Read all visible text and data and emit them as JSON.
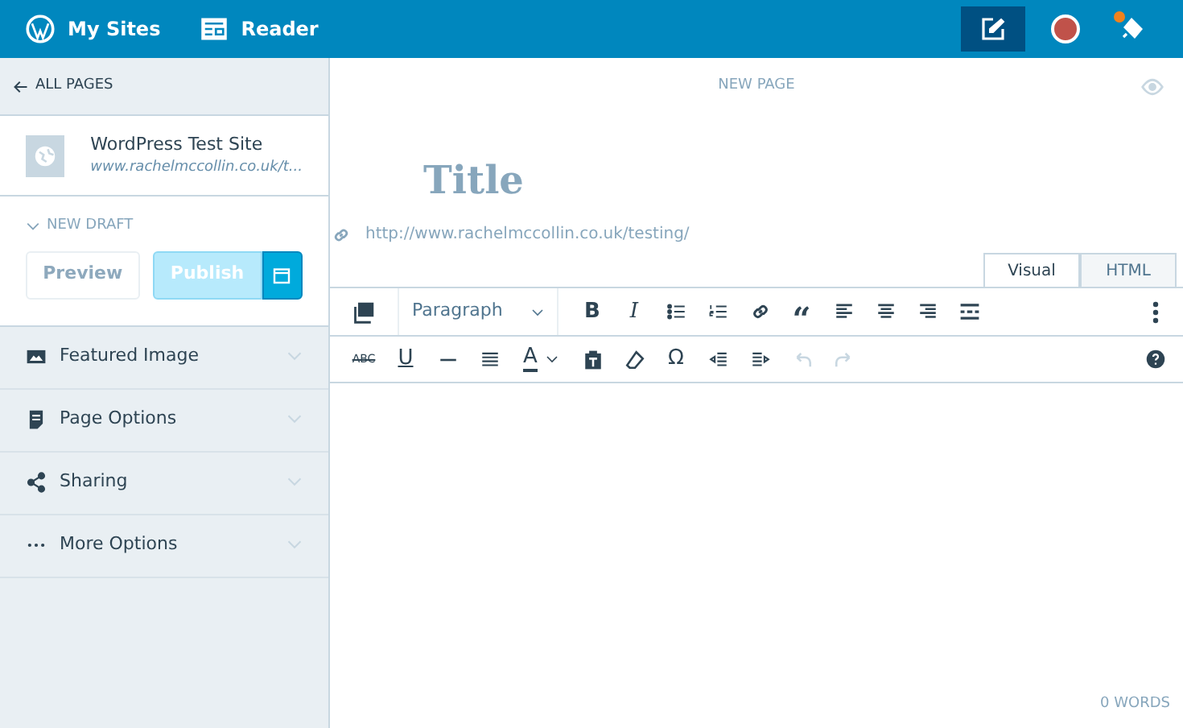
{
  "top_bar": {
    "nav": [
      {
        "label": "My Sites",
        "kind": "wordpress"
      },
      {
        "label": "Reader",
        "kind": "reader"
      }
    ],
    "write_selected": true,
    "notifications_unread": true
  },
  "sidebar": {
    "back_link": "ALL PAGES",
    "site": {
      "name": "WordPress Test Site",
      "url": "www.rachelmccollin.co.uk/t..."
    },
    "status": {
      "label": "NEW DRAFT",
      "expanded": false
    },
    "preview": {
      "label": "Preview",
      "disabled": true
    },
    "publish": {
      "label": "Publish",
      "disabled": true
    },
    "sections": [
      {
        "label": "Featured Image",
        "kind": "image",
        "expanded": false
      },
      {
        "label": "Page Options",
        "kind": "page",
        "expanded": false
      },
      {
        "label": "Sharing",
        "kind": "share",
        "expanded": false
      },
      {
        "label": "More Options",
        "kind": "more",
        "expanded": false
      }
    ]
  },
  "editor": {
    "header": "NEW PAGE",
    "title_placeholder": "Title",
    "permalink": "http://www.rachelmccollin.co.uk/testing/",
    "tabs": [
      {
        "label": "Visual",
        "selected": true
      },
      {
        "label": "HTML",
        "selected": false
      }
    ],
    "format_select": "Paragraph",
    "toolbar_row_1": [
      {
        "kind": "bold",
        "label": "B",
        "disabled": false
      },
      {
        "kind": "italic",
        "label": "I",
        "disabled": false
      },
      {
        "kind": "bullets",
        "disabled": false
      },
      {
        "kind": "numbers",
        "disabled": false
      },
      {
        "kind": "link",
        "disabled": false
      },
      {
        "kind": "quote",
        "label": "“",
        "disabled": false
      },
      {
        "kind": "align-left",
        "disabled": false
      },
      {
        "kind": "align-center",
        "disabled": false
      },
      {
        "kind": "align-right",
        "disabled": false
      },
      {
        "kind": "more-tag",
        "disabled": false
      }
    ],
    "toolbar_row_2": [
      {
        "kind": "strike",
        "label": "ABC",
        "disabled": false
      },
      {
        "kind": "underline",
        "label": "U",
        "disabled": false
      },
      {
        "kind": "hr",
        "disabled": false
      },
      {
        "kind": "justify",
        "disabled": false
      },
      {
        "kind": "color",
        "label": "A",
        "disabled": false
      },
      {
        "kind": "paste",
        "disabled": false
      },
      {
        "kind": "eraser",
        "disabled": false
      },
      {
        "kind": "omega",
        "label": "Ω",
        "disabled": false
      },
      {
        "kind": "outdent",
        "disabled": false
      },
      {
        "kind": "indent",
        "disabled": false
      },
      {
        "kind": "undo",
        "disabled": true
      },
      {
        "kind": "redo",
        "disabled": true
      }
    ],
    "word_count": "0 WORDS"
  }
}
